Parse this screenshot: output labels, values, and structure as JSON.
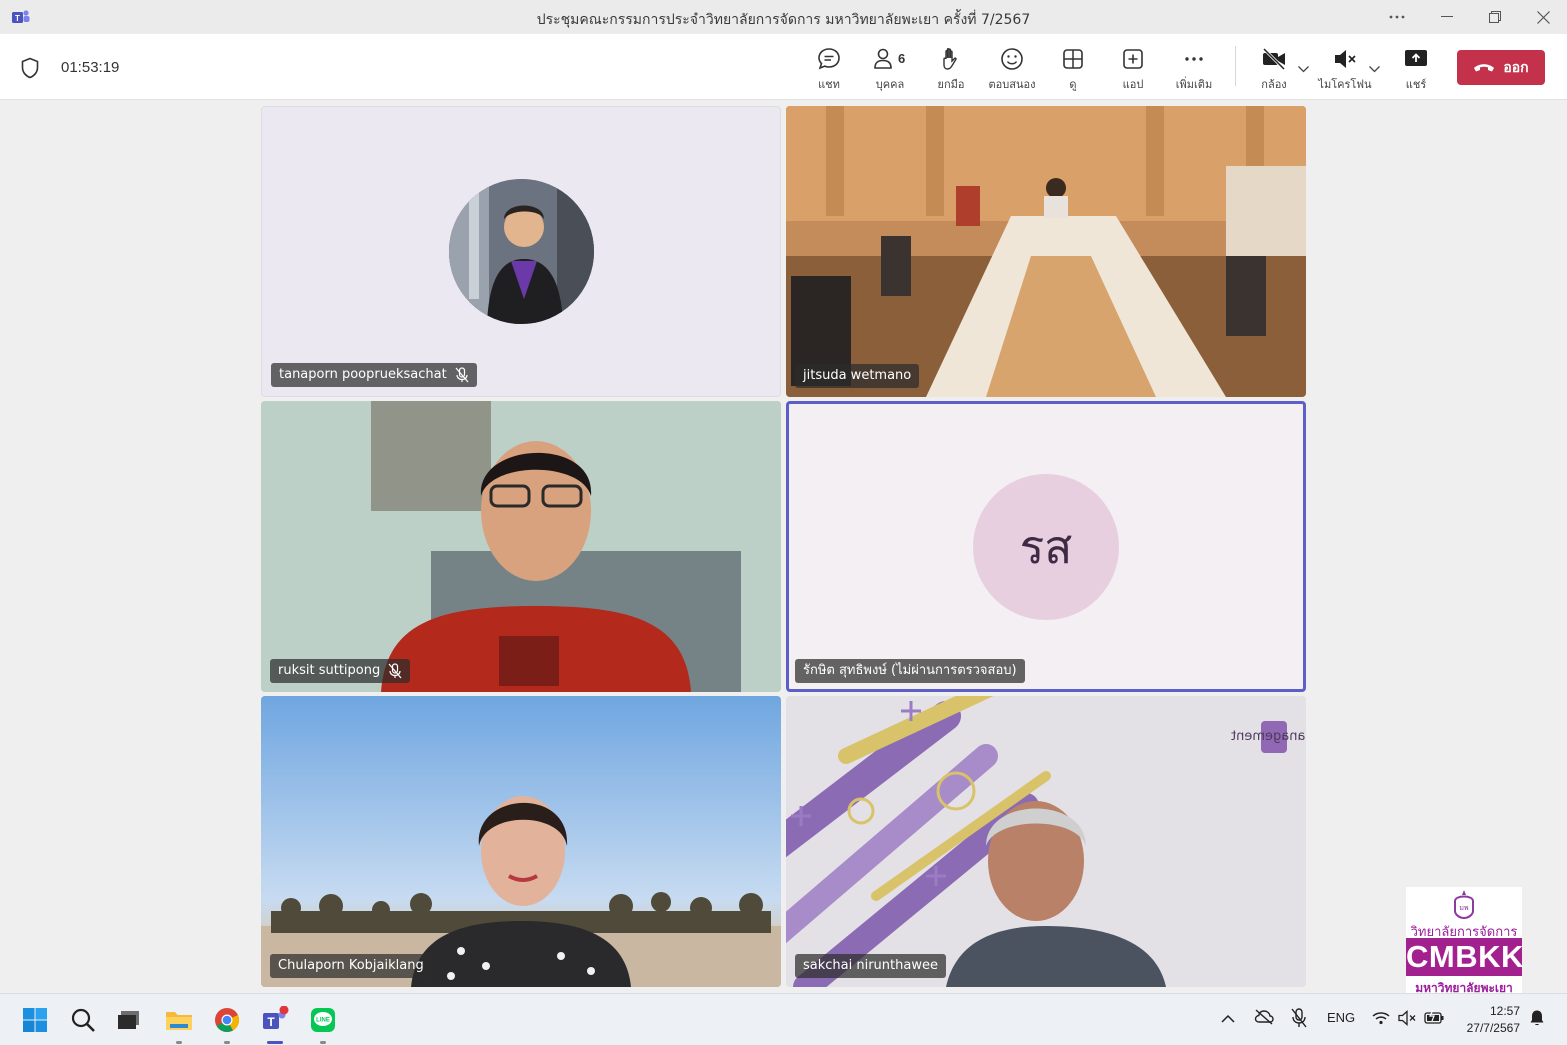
{
  "window": {
    "title": "ประชุมคณะกรรมการประจำวิทยาลัยการจัดการ มหาวิทยาลัยพะเยา ครั้งที่ 7/2567",
    "controls": [
      "more",
      "minimize",
      "restore",
      "close"
    ]
  },
  "toolbar": {
    "timer": "01:53:19",
    "chat_label": "แชท",
    "people_label": "บุคคล",
    "people_count": "6",
    "raise_label": "ยกมือ",
    "react_label": "ตอบสนอง",
    "view_label": "ดู",
    "apps_label": "แอป",
    "more_label": "เพิ่มเติม",
    "camera_label": "กล้อง",
    "mic_label": "ไมโครโฟน",
    "share_label": "แชร์",
    "leave_label": "ออก"
  },
  "participants": [
    {
      "name": "tanaporn pooprueksachat",
      "muted": true,
      "video": false
    },
    {
      "name": "jitsuda wetmano",
      "muted": false,
      "video": true
    },
    {
      "name": "ruksit suttipong",
      "muted": true,
      "video": true
    },
    {
      "name": "รักษิต สุทธิพงษ์ (ไม่ผ่านการตรวจสอบ)",
      "muted": false,
      "video": false,
      "initials": "รส",
      "active_speaker": true
    },
    {
      "name": "Chulaporn Kobjaiklang",
      "muted": false,
      "video": true
    },
    {
      "name": "sakchai nirunthawee",
      "muted": false,
      "video": true
    }
  ],
  "taskbar": {
    "apps": [
      "windows-start",
      "search",
      "task-view",
      "file-explorer",
      "chrome",
      "teams",
      "line"
    ],
    "language": "ENG",
    "time": "12:57",
    "date": "27/7/2567"
  },
  "watermark": {
    "line1": "วิทยาลัยการจัดการ",
    "brand": "CMBKK",
    "line2": "มหาวิทยาลัยพะเยา"
  },
  "colors": {
    "leave_button": "#c4314b",
    "active_speaker_border": "#5b5fc7",
    "brand_purple": "#a3218f"
  }
}
